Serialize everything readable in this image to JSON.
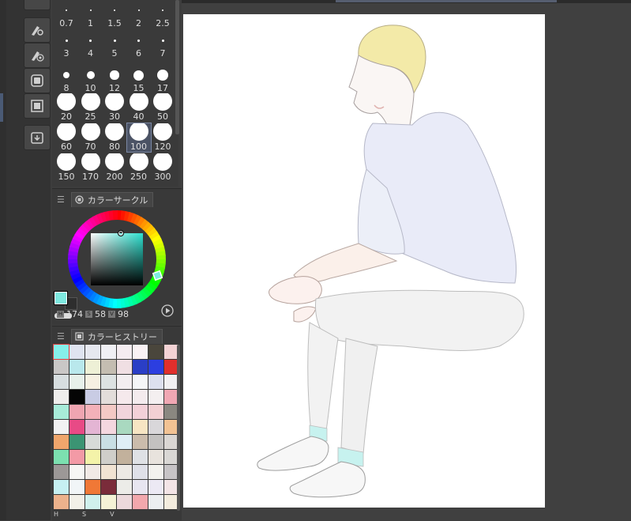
{
  "brush_sizes": [
    [
      "0.7",
      "1",
      "1.5",
      "2",
      "2.5"
    ],
    [
      "3",
      "4",
      "5",
      "6",
      "7"
    ],
    [
      "8",
      "10",
      "12",
      "15",
      "17"
    ],
    [
      "20",
      "25",
      "30",
      "40",
      "50"
    ],
    [
      "60",
      "70",
      "80",
      "100",
      "120"
    ],
    [
      "150",
      "170",
      "200",
      "250",
      "300"
    ]
  ],
  "selected_brush_size": "100",
  "color_circle": {
    "title": "カラーサークル",
    "h_value": "174",
    "s_value": "58",
    "v_value": "98",
    "h_tag": "H",
    "s_tag": "S",
    "v_tag": "V",
    "main_color": "#7ee9e0",
    "sub_color": "#2e2e2e"
  },
  "color_history": {
    "title": "カラーヒストリー",
    "swatches": [
      "#86f0ea",
      "#dfe4f0",
      "#e6e8ef",
      "#f0f0f4",
      "#f4ecf0",
      "#faf2f4",
      "#4a463c",
      "#f3d2d4",
      "#c9c7c6",
      "#b9e8ec",
      "#eef0d6",
      "#c4bdb1",
      "#f0dfe3",
      "#2a3ec6",
      "#2c3ee0",
      "#e02f2c",
      "#d7dee0",
      "#e7f0ea",
      "#f6f0e2",
      "#dde2e2",
      "#f3eef0",
      "#f5f6f8",
      "#dde0ee",
      "#f1f0f2",
      "#efeeec",
      "#050505",
      "#c9cce4",
      "#e3ddda",
      "#f5e9ec",
      "#f4ebee",
      "#f4eff0",
      "#f0a7b3",
      "#a8ecd9",
      "#efa5b1",
      "#f3b1b9",
      "#f4c9c5",
      "#f1d4dc",
      "#f3d0d8",
      "#f2d0d3",
      "#8a8780",
      "#f2f2f3",
      "#e84a86",
      "#e4b5d4",
      "#f4d7df",
      "#a9d9c0",
      "#f7e5c3",
      "#d9d7da",
      "#f2c293",
      "#f0a66c",
      "#3b9473",
      "#d7dad8",
      "#c9dfe4",
      "#dfeef6",
      "#cbbcac",
      "#c3c1c0",
      "#dad6d3",
      "#7ce0b0",
      "#f39aa6",
      "#f4f3a9",
      "#cfcec9",
      "#c2b19c",
      "#dfe1e5",
      "#e8e3dd",
      "#d9d7d4",
      "#9c9897",
      "#f6f6f4",
      "#f1e9e5",
      "#f1e3d2",
      "#ede9e4",
      "#dfe0e8",
      "#f3f2ee",
      "#c7c4c6",
      "#c6f0f2",
      "#f1f5f7",
      "#f07836",
      "#7a2c3a",
      "#ecece8",
      "#e8e6f0",
      "#ece9f4",
      "#f3e4e6",
      "#ecb28c",
      "#f2f0e8",
      "#d0f0ec",
      "#f4f2d6",
      "#ecd9dc",
      "#f2a8ad",
      "#eceef0",
      "#f3ecde"
    ]
  },
  "bottom_tags": [
    "H",
    "S",
    "V"
  ],
  "canvas": {
    "paper_color": "#ffffff"
  }
}
